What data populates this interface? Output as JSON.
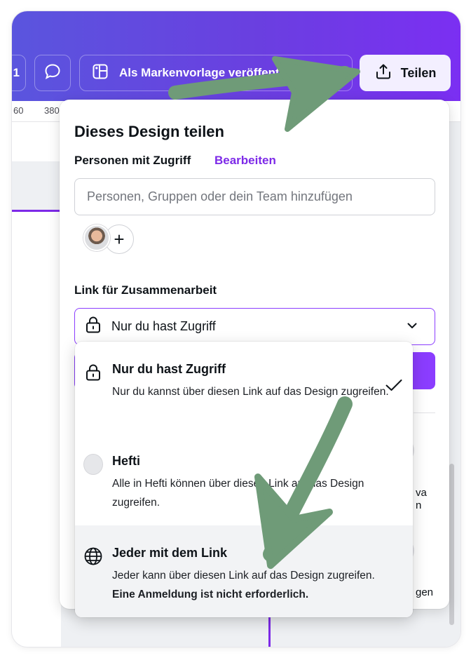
{
  "topbar": {
    "fragment_label": "1",
    "brand_button_label": "Als Markenvorlage veröffentli",
    "share_button_label": "Teilen"
  },
  "ruler": {
    "ticks": [
      "60",
      "380"
    ]
  },
  "share_panel": {
    "title": "Dieses Design teilen",
    "access_label": "Personen mit Zugriff",
    "edit_link": "Bearbeiten",
    "people_input_placeholder": "Personen, Gruppen oder dein Team hinzufügen",
    "add_person_glyph": "+",
    "collab_link_label": "Link für Zusammenarbeit",
    "selected_option": "Nur du hast Zugriff",
    "background_fragments": [
      "va",
      "n",
      "gen"
    ]
  },
  "dropdown": {
    "options": [
      {
        "icon": "lock-icon",
        "title": "Nur du hast Zugriff",
        "description": "Nur du kannst über diesen Link auf das Design zugreifen.",
        "selected": true
      },
      {
        "icon": "team-icon",
        "title": "Hefti",
        "description": "Alle in Hefti können über diesen Link auf das Design zugreifen.",
        "selected": false
      },
      {
        "icon": "globe-icon",
        "title": "Jeder mit dem Link",
        "description": "Jeder kann über diesen Link auf das Design zugreifen.",
        "note": "Eine Anmeldung ist nicht erforderlich.",
        "selected": false
      }
    ]
  },
  "colors": {
    "brand_purple": "#8b3dff",
    "link_purple": "#7d2ae8",
    "annotation_green": "#6f9b78"
  }
}
